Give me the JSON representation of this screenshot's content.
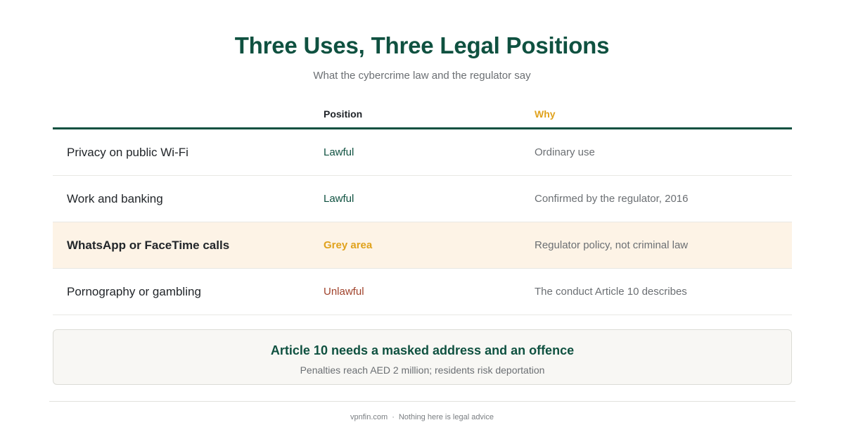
{
  "header": {
    "title": "Three Uses, Three Legal Positions",
    "subtitle": "What the cybercrime law and the regulator say"
  },
  "table": {
    "columns": {
      "use": "",
      "position": "Position",
      "why": "Why"
    },
    "rows": [
      {
        "use": "Privacy on public Wi-Fi",
        "position": "Lawful",
        "position_color": "#0f5140",
        "why": "Ordinary use",
        "highlighted": false
      },
      {
        "use": "Work and banking",
        "position": "Lawful",
        "position_color": "#0f5140",
        "why": "Confirmed by the regulator, 2016",
        "highlighted": false
      },
      {
        "use": "WhatsApp or FaceTime calls",
        "position": "Grey area",
        "position_color": "#e0a21d",
        "why": "Regulator policy, not criminal law",
        "highlighted": true
      },
      {
        "use": "Pornography or gambling",
        "position": "Unlawful",
        "position_color": "#a0422b",
        "why": "The conduct Article 10 describes",
        "highlighted": false
      }
    ]
  },
  "callout": {
    "title": "Article 10 needs a masked address and an offence",
    "text": "Penalties reach AED 2 million; residents risk deportation"
  },
  "footer": {
    "site": "vpnfin.com",
    "separator": "·",
    "disclaimer": "Nothing here is legal advice"
  },
  "colors": {
    "accent": "#0f5140",
    "highlight": "#e0a21d",
    "warning": "#a0422b",
    "highlight_bg": "#fdf3e6"
  }
}
